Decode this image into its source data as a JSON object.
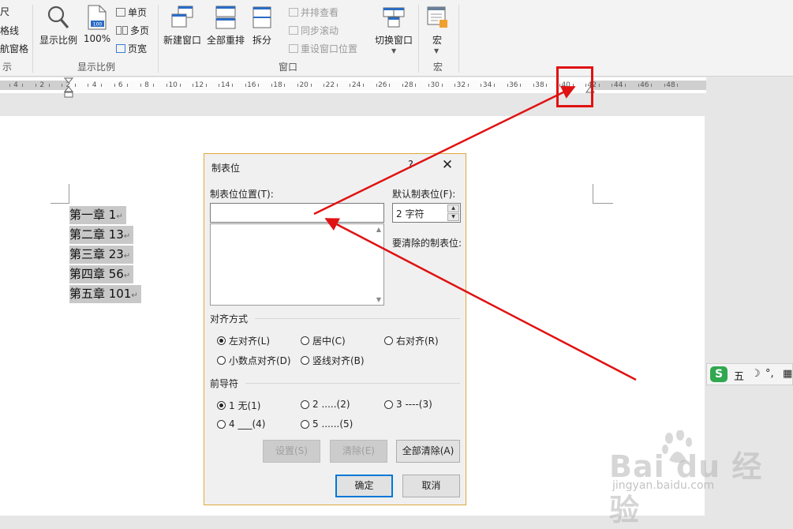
{
  "ribbon": {
    "cut_left": [
      "尺",
      "格线",
      "航窗格"
    ],
    "cut_group": "示",
    "zoom_group": {
      "label": "显示比例",
      "zoom_button": "显示比例",
      "hundred_button": "100%",
      "hundred_badge": "100",
      "one_page": "单页",
      "multi_page": "多页",
      "page_width": "页宽"
    },
    "window_group": {
      "label": "窗口",
      "new_window": "新建窗口",
      "arrange_all": "全部重排",
      "split": "拆分",
      "side_by_side": "并排查看",
      "sync_scroll": "同步滚动",
      "reset_position": "重设窗口位置",
      "switch_window": "切换窗口"
    },
    "macro_group": {
      "label": "宏",
      "macro_button": "宏"
    }
  },
  "ruler": {
    "numbers": [
      "4",
      "2",
      "2",
      "4",
      "6",
      "8",
      "10",
      "12",
      "14",
      "16",
      "18",
      "20",
      "22",
      "24",
      "26",
      "28",
      "30",
      "32",
      "34",
      "36",
      "38",
      "40",
      "42",
      "44",
      "46",
      "48"
    ]
  },
  "document": {
    "lines": [
      "第一章 1",
      "第二章 13",
      "第三章 23",
      "第四章 56",
      "第五章 101"
    ],
    "para_mark": "↵"
  },
  "dialog": {
    "title": "制表位",
    "help": "?",
    "close": "✕",
    "tab_position_label": "制表位位置(T):",
    "tab_position_value": "",
    "default_tab_label": "默认制表位(F):",
    "default_tab_value": "2 字符",
    "clear_label": "要清除的制表位:",
    "alignment_title": "对齐方式",
    "alignment": [
      {
        "label": "左对齐(L)",
        "checked": true
      },
      {
        "label": "居中(C)",
        "checked": false
      },
      {
        "label": "右对齐(R)",
        "checked": false
      },
      {
        "label": "小数点对齐(D)",
        "checked": false
      },
      {
        "label": "竖线对齐(B)",
        "checked": false
      }
    ],
    "leader_title": "前导符",
    "leader": [
      {
        "label": "1 无(1)",
        "checked": true
      },
      {
        "label": "2 .....(2)",
        "checked": false
      },
      {
        "label": "3 ----(3)",
        "checked": false
      },
      {
        "label": "4 ___(4)",
        "checked": false
      },
      {
        "label": "5 ......(5)",
        "checked": false
      }
    ],
    "buttons": {
      "set": "设置(S)",
      "clear": "清除(E)",
      "clear_all": "全部清除(A)",
      "ok": "确定",
      "cancel": "取消"
    }
  },
  "ime": {
    "logo": "S",
    "mode": "五",
    "moon": "☽",
    "punct": "°,"
  },
  "watermark": {
    "text": "Bai du 经验",
    "url": "jingyan.baidu.com"
  },
  "colors": {
    "annotation_red": "#e01212",
    "focus_blue": "#0078d7",
    "dialog_border": "#e0a93c",
    "ime_green": "#2fa84f"
  }
}
